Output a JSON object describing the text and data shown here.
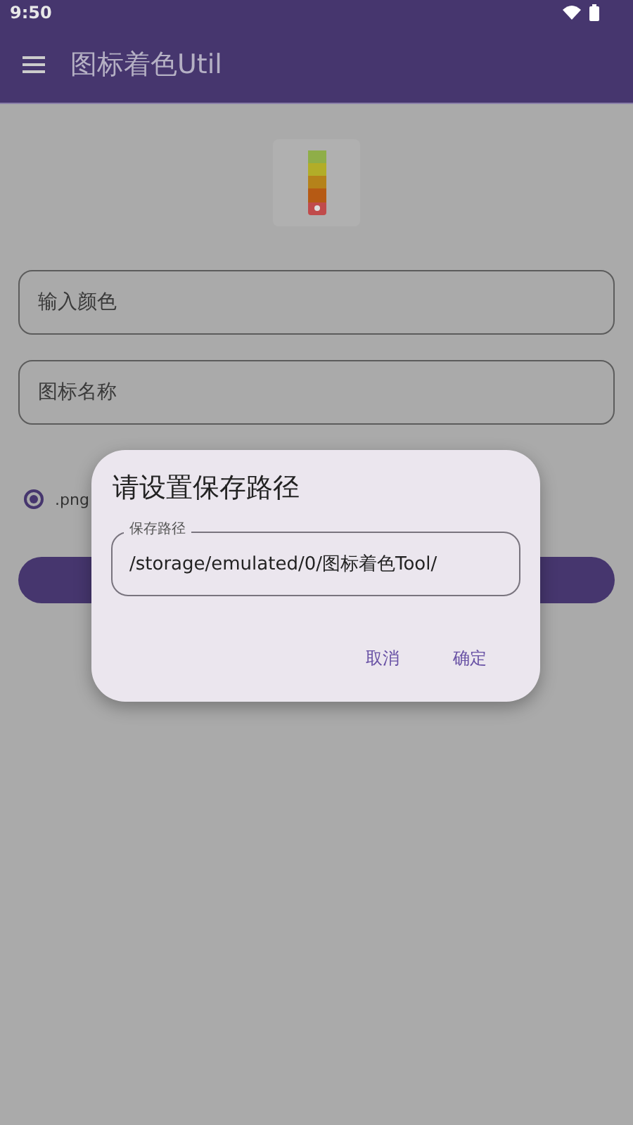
{
  "status_bar": {
    "time": "9:50"
  },
  "app_bar": {
    "title": "图标着色Util"
  },
  "form": {
    "fields": [
      {
        "placeholder": "输入颜色"
      },
      {
        "placeholder": "图标名称"
      }
    ],
    "formats": [
      {
        "label": ".png",
        "selected": true
      }
    ]
  },
  "dialog": {
    "title": "请设置保存路径",
    "field": {
      "label": "保存路径",
      "value": "/storage/emulated/0/图标着色Tool/"
    },
    "buttons": [
      "取消",
      "确定"
    ]
  }
}
